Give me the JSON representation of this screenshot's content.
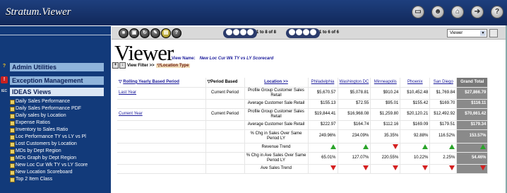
{
  "app": {
    "title": "Stratum.Viewer"
  },
  "top_icons": [
    "monitor-icon",
    "users-icon",
    "home-icon",
    "logout-icon",
    "help-icon"
  ],
  "sidebar": {
    "sections": [
      {
        "label": "Admin Utilities",
        "marker": "?"
      },
      {
        "label": "Exception Management",
        "marker": "!"
      },
      {
        "label": "IDEAS Views",
        "marker": "IEC"
      }
    ],
    "items": [
      "Daily Sales Performance",
      "Daily Sales Performance PDF",
      "Daily sales by Location",
      "Expense Ratios",
      "Inventory to Sales Ratio",
      "Loc Performance TY vs LY vs Pl",
      "Lost Customers by Location",
      "MDs by Dept Region",
      "MDs Graph by Dept Region",
      "New Loc Cur Wk TY vs LY Score",
      "New Location Scoreboard",
      "Top 2 Item Class"
    ]
  },
  "toolbar": {
    "page_info_1": "1 to 8 of 8",
    "page_info_2": "1 to 6 of 6",
    "viewer_select": "Viewer"
  },
  "main": {
    "title": "Viewer",
    "view_name_label": "View Name:",
    "view_name": "New Loc Cur Wk TY vs LY Scorecard",
    "view_filter": "View Filter >>",
    "location_type": "Location Type"
  },
  "table": {
    "headers": {
      "rolling": "Rolling Yearly Based Period",
      "period": "Period Based",
      "location": "Location >>",
      "cities": [
        "Philadelphia",
        "Washington DC",
        "Minneapolis",
        "Phoenix",
        "San Diego"
      ],
      "grand": "Grand Total"
    },
    "rows": [
      {
        "group": "Last Year",
        "period": "Current Period",
        "metric": "Profile Group Customer Sales Retail",
        "values": [
          "$5,670.57",
          "$5,078.81",
          "$910.24",
          "$10,452.48",
          "$1,769.84"
        ],
        "grand": "$27,866.79"
      },
      {
        "group": "",
        "period": "",
        "metric": "Average Customer Sale Retail",
        "values": [
          "$155.13",
          "$72.55",
          "$95.01",
          "$155.42",
          "$169.70"
        ],
        "grand": "$116.11"
      },
      {
        "group": "Current Year",
        "period": "Current Period",
        "metric": "Profile Group Customer Sales Retail",
        "values": [
          "$19,844.41",
          "$16,968.08",
          "$1,259.80",
          "$20,120.21",
          "$12,492.92"
        ],
        "grand": "$70,661.42"
      },
      {
        "group": "",
        "period": "",
        "metric": "Average Customer Sale Retail",
        "values": [
          "$222.97",
          "$164.74",
          "$112.16",
          "$169.09",
          "$179.51"
        ],
        "grand": "$179.34"
      },
      {
        "group": "",
        "period": "",
        "metric": "% Chg in Sales Over Same Period LY",
        "values": [
          "249.96%",
          "234.09%",
          "35.35%",
          "92.88%",
          "116.52%"
        ],
        "grand": "153.57%"
      },
      {
        "group": "",
        "period": "",
        "metric": "Revenue Trend",
        "trend": [
          "up",
          "up",
          "down",
          "up",
          "up"
        ],
        "grand_trend": "up"
      },
      {
        "group": "",
        "period": "",
        "metric": "% Chg in Ave Sales Over Same Period LY",
        "values": [
          "65.01%",
          "127.07%",
          "220.55%",
          "10.22%",
          "2.25%"
        ],
        "grand": "54.46%"
      },
      {
        "group": "",
        "period": "",
        "metric": "Ave Sales Trend",
        "trend": [
          "down",
          "down",
          "down",
          "down",
          "down"
        ],
        "grand_trend": "down"
      }
    ]
  }
}
